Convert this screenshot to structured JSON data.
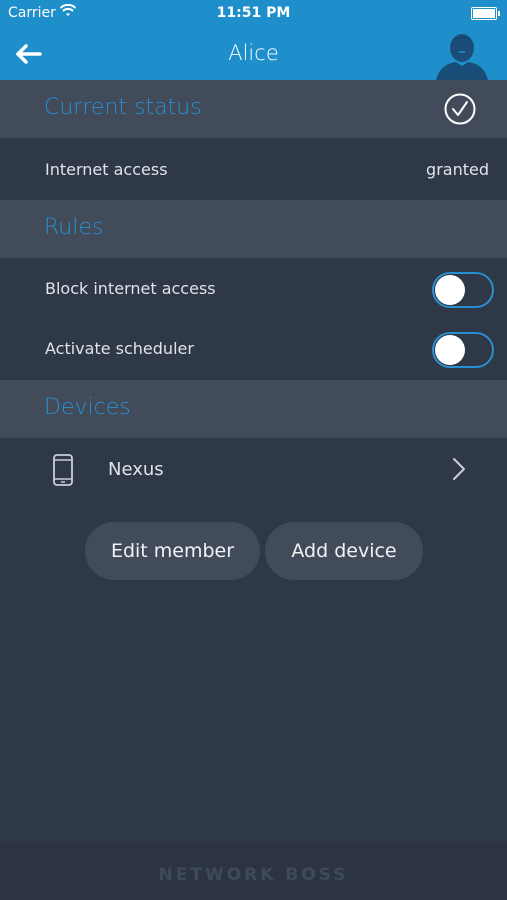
{
  "status_bar": {
    "carrier": "Carrier",
    "time": "11:51 PM"
  },
  "nav": {
    "title": "Alice"
  },
  "sections": {
    "status": {
      "title": "Current status",
      "internet_label": "Internet access",
      "internet_value": "granted"
    },
    "rules": {
      "title": "Rules",
      "block_label": "Block internet access",
      "scheduler_label": "Activate scheduler"
    },
    "devices": {
      "title": "Devices",
      "items": [
        {
          "name": "Nexus"
        }
      ]
    }
  },
  "actions": {
    "edit_member": "Edit member",
    "add_device": "Add device"
  },
  "footer": {
    "brand": "NETWORK BOSS"
  },
  "toggles": {
    "block_internet": false,
    "scheduler": false
  },
  "colors": {
    "primary": "#1f8fcb",
    "accent": "#2a8fd0",
    "background": "#2f3847",
    "header": "#414b5a"
  },
  "icons": {
    "back": "back-arrow-icon",
    "status": "checkmark-circle-icon",
    "device": "smartphone-icon",
    "disclosure": "chevron-right-icon"
  }
}
